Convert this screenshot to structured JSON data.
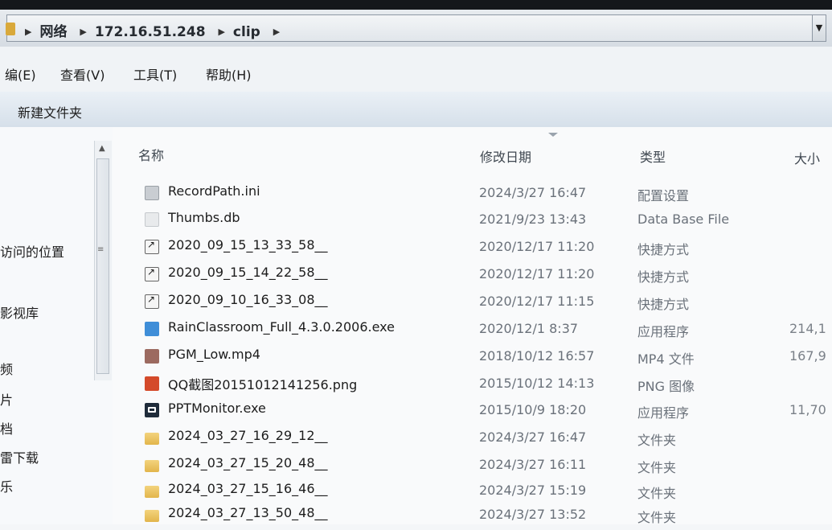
{
  "address": {
    "crumbs": [
      "网络",
      "172.16.51.248",
      "clip"
    ],
    "dropdown_icon": "chevron-down-icon"
  },
  "menu": [
    "编(E)",
    "查看(V)",
    "工具(T)",
    "帮助(H)"
  ],
  "toolbar": {
    "new_folder": "新建文件夹"
  },
  "nav": {
    "items": [
      "",
      "",
      "",
      "访问的位置",
      "",
      "影视库",
      "频",
      "片",
      "档",
      "雷下载",
      "乐"
    ],
    "grip": "≡"
  },
  "columns": {
    "name": "名称",
    "date": "修改日期",
    "type": "类型",
    "size": "大小"
  },
  "files": [
    {
      "icon": "ini",
      "name": "RecordPath.ini",
      "date": "2024/3/27 16:47",
      "type": "配置设置",
      "size": ""
    },
    {
      "icon": "db",
      "name": "Thumbs.db",
      "date": "2021/9/23 13:43",
      "type": "Data Base File",
      "size": ""
    },
    {
      "icon": "lnk",
      "name": "2020_09_15_13_33_58__",
      "date": "2020/12/17 11:20",
      "type": "快捷方式",
      "size": ""
    },
    {
      "icon": "lnk",
      "name": "2020_09_15_14_22_58__",
      "date": "2020/12/17 11:20",
      "type": "快捷方式",
      "size": ""
    },
    {
      "icon": "lnk",
      "name": "2020_09_10_16_33_08__",
      "date": "2020/12/17 11:15",
      "type": "快捷方式",
      "size": ""
    },
    {
      "icon": "rain",
      "name": "RainClassroom_Full_4.3.0.2006.exe",
      "date": "2020/12/1 8:37",
      "type": "应用程序",
      "size": "214,1"
    },
    {
      "icon": "video",
      "name": "PGM_Low.mp4",
      "date": "2018/10/12 16:57",
      "type": "MP4 文件",
      "size": "167,9"
    },
    {
      "icon": "png",
      "name": "QQ截图20151012141256.png",
      "date": "2015/10/12 14:13",
      "type": "PNG 图像",
      "size": ""
    },
    {
      "icon": "ppt",
      "name": "PPTMonitor.exe",
      "date": "2015/10/9 18:20",
      "type": "应用程序",
      "size": "11,70"
    },
    {
      "icon": "folder",
      "name": "2024_03_27_16_29_12__",
      "date": "2024/3/27 16:47",
      "type": "文件夹",
      "size": ""
    },
    {
      "icon": "folder",
      "name": "2024_03_27_15_20_48__",
      "date": "2024/3/27 16:11",
      "type": "文件夹",
      "size": ""
    },
    {
      "icon": "folder",
      "name": "2024_03_27_15_16_46__",
      "date": "2024/3/27 15:19",
      "type": "文件夹",
      "size": ""
    },
    {
      "icon": "folder",
      "name": "2024_03_27_13_50_48__",
      "date": "2024/3/27 13:52",
      "type": "文件夹",
      "size": ""
    }
  ]
}
